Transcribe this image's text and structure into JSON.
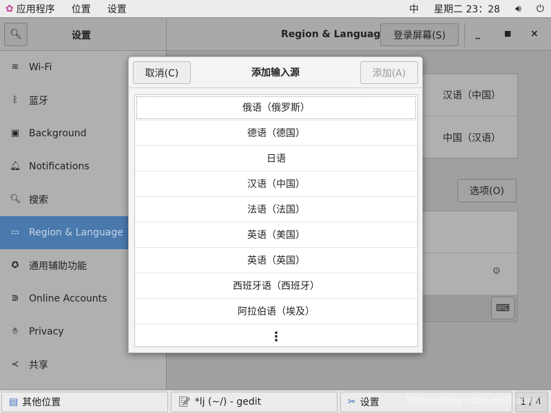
{
  "topbar": {
    "apps": "应用程序",
    "places": "位置",
    "settings": "设置",
    "ime": "中",
    "clock": "星期二 23：28"
  },
  "header": {
    "sidebar_title": "设置",
    "title": "Region & Language",
    "login_screen": "登录屏幕(S)"
  },
  "sidebar": {
    "items": [
      {
        "label": "Wi-Fi",
        "icon": "wifi-icon"
      },
      {
        "label": "蓝牙",
        "icon": "bluetooth-icon"
      },
      {
        "label": "Background",
        "icon": "background-icon"
      },
      {
        "label": "Notifications",
        "icon": "bell-icon"
      },
      {
        "label": "搜索",
        "icon": "search-icon"
      },
      {
        "label": "Region & Language",
        "icon": "region-icon",
        "selected": true
      },
      {
        "label": "通用辅助功能",
        "icon": "accessibility-icon"
      },
      {
        "label": "Online Accounts",
        "icon": "online-accounts-icon"
      },
      {
        "label": "Privacy",
        "icon": "hand-icon"
      },
      {
        "label": "共享",
        "icon": "share-icon"
      }
    ]
  },
  "main": {
    "language": "汉语（中国）",
    "formats": "中国（汉语）",
    "options": "选项(O)"
  },
  "dialog": {
    "cancel": "取消(C)",
    "title": "添加输入源",
    "add": "添加(A)",
    "items": [
      "俄语（俄罗斯）",
      "德语（德国）",
      "日语",
      "汉语（中国）",
      "法语（法国）",
      "英语（美国）",
      "英语（英国）",
      "西班牙语（西班牙）",
      "阿拉伯语（埃及）"
    ],
    "more": "⋮"
  },
  "taskbar": {
    "items": [
      "其他位置",
      "*lj (~/) - gedit",
      "设置"
    ],
    "pager": "1 / 4"
  },
  "watermark": "https://blog.csdn.net/liubing"
}
